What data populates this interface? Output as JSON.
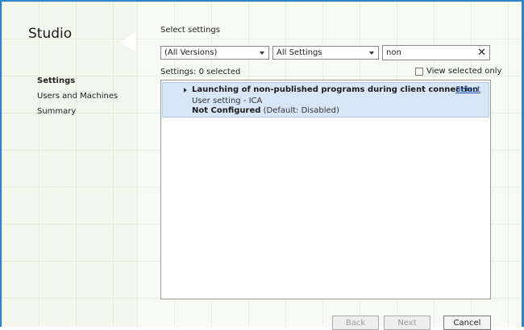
{
  "app": {
    "title": "Studio"
  },
  "nav": {
    "items": [
      {
        "label": "Settings"
      },
      {
        "label": "Users and Machines"
      },
      {
        "label": "Summary"
      }
    ]
  },
  "main": {
    "heading": "Select settings",
    "filters": {
      "version": "(All Versions)",
      "category": "All Settings",
      "search_value": "non"
    },
    "settings_count": "Settings: 0 selected",
    "view_selected_label": "View selected only",
    "list": [
      {
        "title": "Launching of non-published programs during client connection",
        "subtitle": "User setting - ICA",
        "status_value": "Not Configured",
        "status_default": "(Default: Disabled)",
        "action": "Select"
      }
    ]
  },
  "footer": {
    "back": "Back",
    "next": "Next",
    "cancel": "Cancel"
  },
  "colors": {
    "accent": "#2a86c8",
    "selected_row": "#d7e7f8",
    "link": "#1a4fb0"
  }
}
